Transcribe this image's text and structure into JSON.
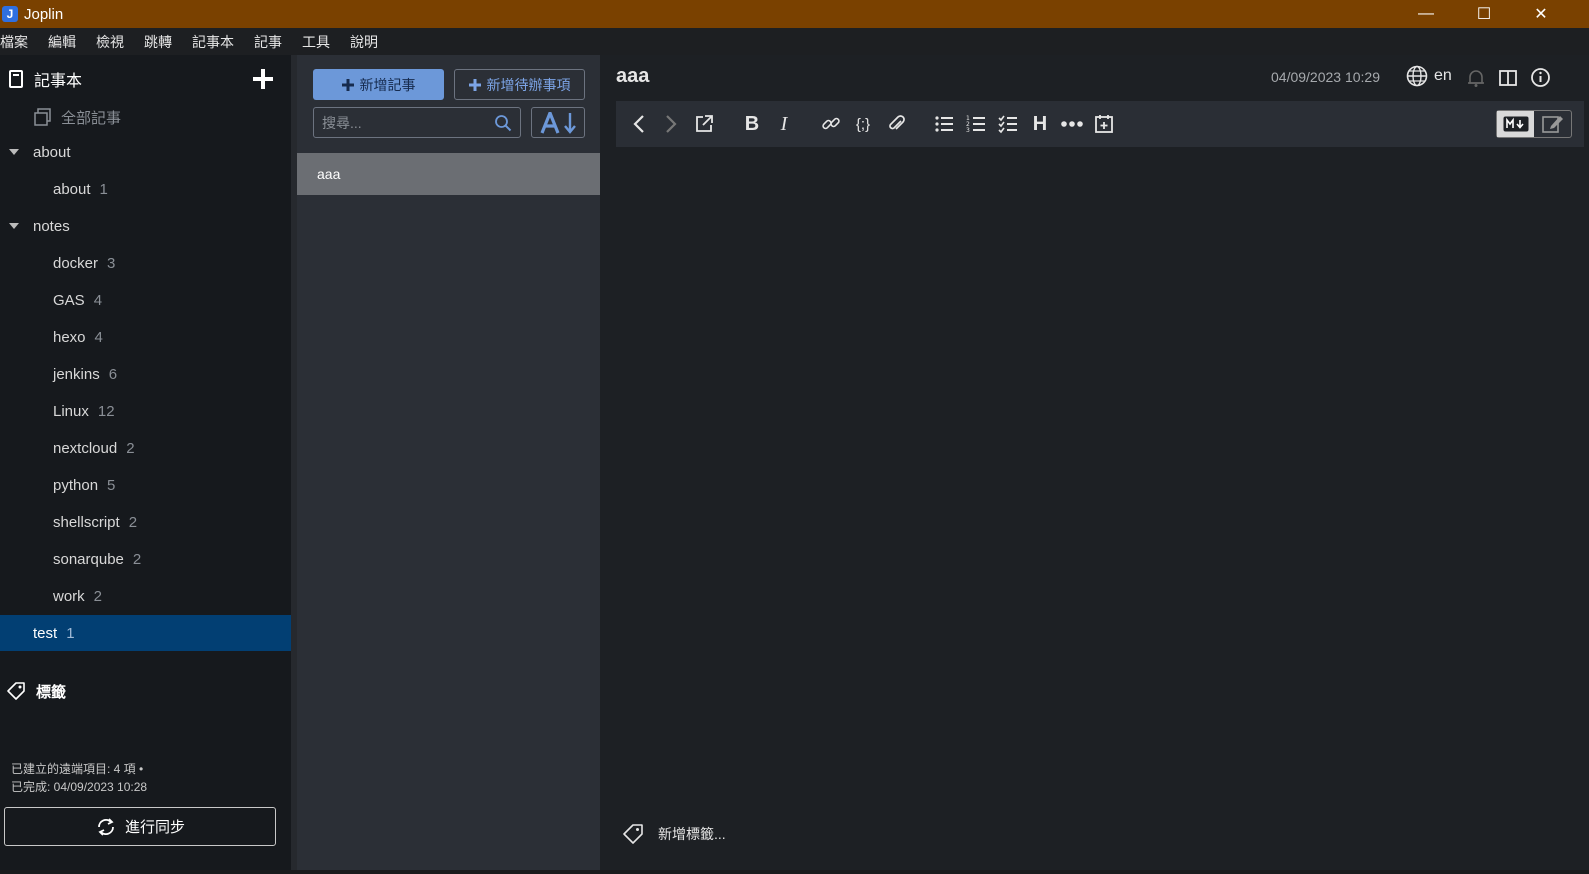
{
  "window": {
    "title": "Joplin",
    "app_icon_letter": "J",
    "minimize": "—",
    "maximize": "☐",
    "close": "✕"
  },
  "menu": [
    "檔案",
    "編輯",
    "檢視",
    "跳轉",
    "記事本",
    "記事",
    "工具",
    "說明"
  ],
  "sidebar": {
    "title": "記事本",
    "all_notes": "全部記事",
    "notebooks": [
      {
        "name": "about",
        "count": "",
        "level": 0,
        "expanded": true
      },
      {
        "name": "about",
        "count": "1",
        "level": 1
      },
      {
        "name": "notes",
        "count": "",
        "level": 0,
        "expanded": true
      },
      {
        "name": "docker",
        "count": "3",
        "level": 1
      },
      {
        "name": "GAS",
        "count": "4",
        "level": 1
      },
      {
        "name": "hexo",
        "count": "4",
        "level": 1
      },
      {
        "name": "jenkins",
        "count": "6",
        "level": 1
      },
      {
        "name": "Linux",
        "count": "12",
        "level": 1
      },
      {
        "name": "nextcloud",
        "count": "2",
        "level": 1
      },
      {
        "name": "python",
        "count": "5",
        "level": 1
      },
      {
        "name": "shellscript",
        "count": "2",
        "level": 1
      },
      {
        "name": "sonarqube",
        "count": "2",
        "level": 1
      },
      {
        "name": "work",
        "count": "2",
        "level": 1
      },
      {
        "name": "test",
        "count": "1",
        "level": 0,
        "selected": true
      }
    ],
    "tags_title": "標籤",
    "sync_status_line1": "已建立的遠端項目: 4 項 •",
    "sync_status_line2": "已完成: 04/09/2023 10:28",
    "sync_button": "進行同步"
  },
  "notelist": {
    "new_note": "新增記事",
    "new_todo": "新增待辦事項",
    "search_placeholder": "搜尋...",
    "notes": [
      {
        "title": "aaa"
      }
    ]
  },
  "editor": {
    "title": "aaa",
    "date": "04/09/2023 10:29",
    "language": "en",
    "heading_button": "H",
    "bold_button": "B",
    "italic_button": "I",
    "code_button": "{;}",
    "add_tags": "新增標籤..."
  },
  "colors": {
    "titlebar": "#7a4100",
    "selected_notebook": "#023f73",
    "accent": "#6c98d9"
  }
}
